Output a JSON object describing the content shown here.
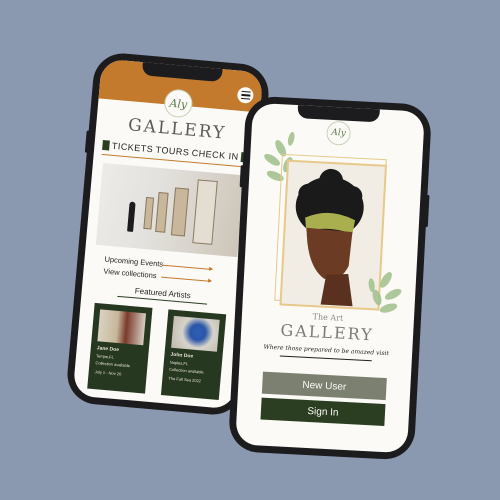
{
  "left_phone": {
    "logo_text": "Aly",
    "menu_icon": "hamburger-menu-icon",
    "title": "GALLERY",
    "tabs": [
      "TICKETS",
      "TOURS",
      "CHECK IN"
    ],
    "links": [
      "Upcoming Events",
      "View collections"
    ],
    "featured_heading": "Featured Artists",
    "cards": [
      {
        "name": "Jane Doe",
        "lines": [
          "Tempe,FL",
          "Collection available",
          "July 1 - Nov 20"
        ]
      },
      {
        "name": "John Doe",
        "lines": [
          "Naples,FL",
          "Collection available",
          "The Fall Sea 2022"
        ]
      }
    ],
    "colors": {
      "header": "#c47a2d",
      "accent_dark": "#2c3e22",
      "card_bg": "#263820"
    }
  },
  "right_phone": {
    "logo_text": "Aly",
    "subtitle": "The Art",
    "title": "GALLERY",
    "tagline": "Where those prepared to be amazed visit",
    "buttons": {
      "new_user": "New User",
      "sign_in": "Sign In"
    },
    "colors": {
      "new_user_bg": "#7b8070",
      "sign_in_bg": "#2c3e22",
      "frame": "#e6c98b"
    }
  }
}
